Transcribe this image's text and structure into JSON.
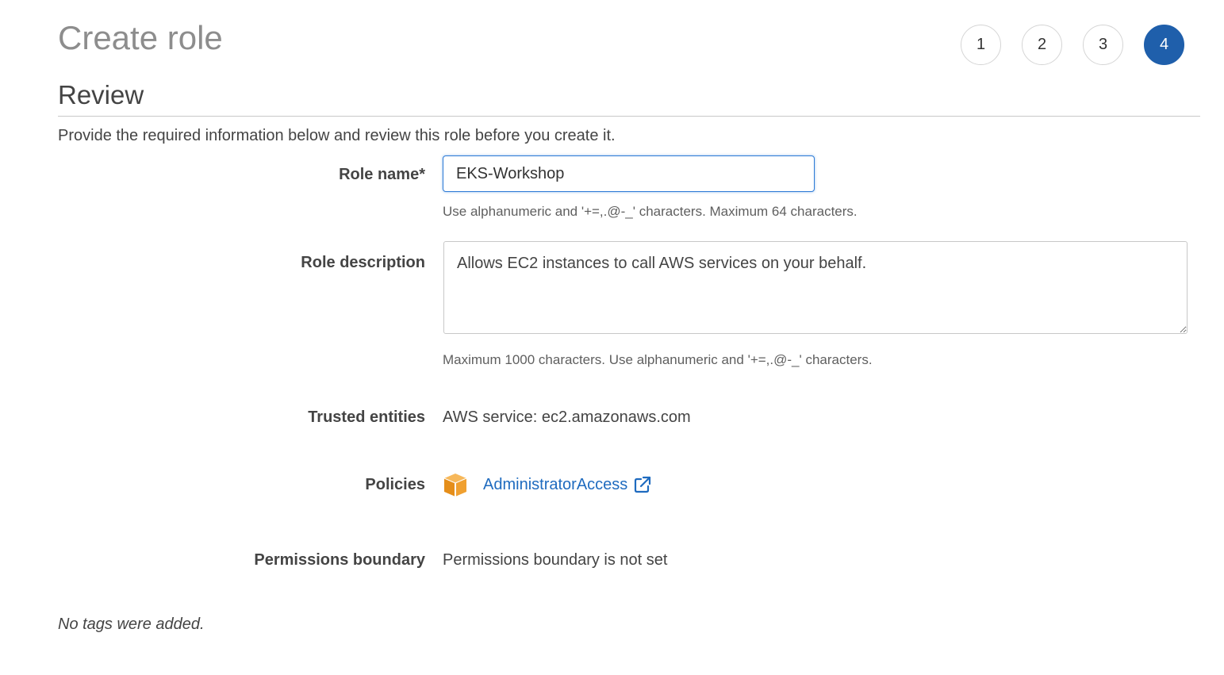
{
  "page_title": "Create role",
  "steps": [
    {
      "label": "1",
      "active": false
    },
    {
      "label": "2",
      "active": false
    },
    {
      "label": "3",
      "active": false
    },
    {
      "label": "4",
      "active": true
    }
  ],
  "section": {
    "title": "Review",
    "intro": "Provide the required information below and review this role before you create it."
  },
  "form": {
    "role_name": {
      "label": "Role name*",
      "value": "EKS-Workshop",
      "help": "Use alphanumeric and '+=,.@-_' characters. Maximum 64 characters."
    },
    "role_description": {
      "label": "Role description",
      "value": "Allows EC2 instances to call AWS services on your behalf.",
      "help": "Maximum 1000 characters. Use alphanumeric and '+=,.@-_' characters."
    },
    "trusted_entities": {
      "label": "Trusted entities",
      "value": "AWS service: ec2.amazonaws.com"
    },
    "policies": {
      "label": "Policies",
      "items": [
        {
          "name": "AdministratorAccess",
          "icon": "aws-managed-policy-cube-icon",
          "link_icon": "external-link-icon"
        }
      ]
    },
    "permissions_boundary": {
      "label": "Permissions boundary",
      "value": "Permissions boundary is not set"
    }
  },
  "tags_note": "No tags were added.",
  "colors": {
    "active_step": "#1f5fab",
    "link": "#1f6bbf",
    "policy_icon": "#f0a030",
    "input_focus": "#2e7bd6"
  }
}
